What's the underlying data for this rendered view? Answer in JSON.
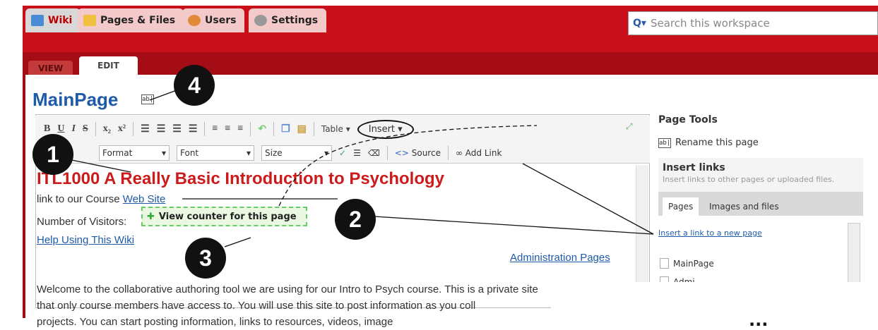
{
  "tabs": [
    {
      "label": "Wiki",
      "icon": "pencil-icon",
      "active": true
    },
    {
      "label": "Pages & Files",
      "icon": "folder-icon",
      "active": false
    },
    {
      "label": "Users",
      "icon": "user-icon",
      "active": false
    },
    {
      "label": "Settings",
      "icon": "gear-icon",
      "active": false
    }
  ],
  "search": {
    "placeholder": "Search this workspace"
  },
  "modes": {
    "view": "VIEW",
    "edit": "EDIT"
  },
  "page": {
    "title": "MainPage"
  },
  "toolbar": {
    "format": "Format",
    "font": "Font",
    "size": "Size",
    "source": "Source",
    "add_link": "Add Link",
    "table": "Table",
    "insert": "Insert"
  },
  "content": {
    "heading": "ITL1000 A Really Basic Introduction to Psychology",
    "line1_prefix": "link to our Course ",
    "line1_link": "Web Site",
    "visitors_label": "Number of Visitors:",
    "widget": "View counter for this page",
    "help_link": "Help Using This Wiki",
    "admin_link": "Administration Pages",
    "para1": "Welcome to the collaborative authoring tool we are using for our  Intro to Psych course.  This is a private site",
    "para2": "that only course members have access to.  You will use this site to post information as you coll",
    "para3": "projects.  You can start posting information, links to resources, videos, image"
  },
  "page_tools": {
    "title": "Page Tools",
    "rename": "Rename this page",
    "insert_links_title": "Insert links",
    "insert_links_sub": "Insert links to other pages or uploaded files.",
    "tab_pages": "Pages",
    "tab_images": "Images and files",
    "new_page_link": "Insert a link to a new page",
    "items": [
      "MainPage",
      "Admi..."
    ]
  },
  "callouts": [
    "1",
    "2",
    "3",
    "4"
  ],
  "ellipsis": "..."
}
